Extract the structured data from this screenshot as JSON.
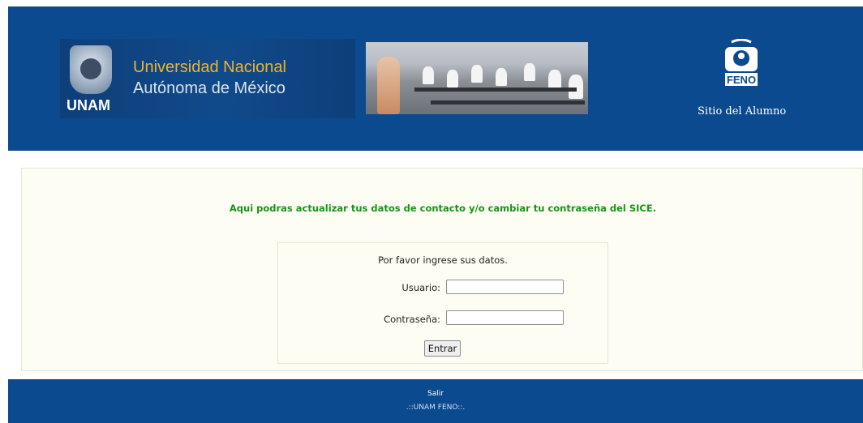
{
  "header": {
    "unam_acronym": "UNAM",
    "unam_name_line1": "Universidad Nacional",
    "unam_name_line2": "Autónoma de México",
    "feno_logo_text": "FENO",
    "sitio_label": "Sitio del Alumno"
  },
  "main": {
    "intro_text": "Aqui podras actualizar tus datos de contacto y/o cambiar tu contraseña del SICE.",
    "prompt": "Por favor ingrese sus datos.",
    "usuario_label": "Usuario:",
    "usuario_value": "",
    "password_label": "Contraseña:",
    "password_value": "",
    "submit_label": "Entrar"
  },
  "footer": {
    "exit_label": "Salir",
    "brand": ".::UNAM FENO::."
  },
  "colors": {
    "header_blue": "#0b4a8f",
    "intro_green": "#179317",
    "content_bg": "#fdfdf3"
  }
}
